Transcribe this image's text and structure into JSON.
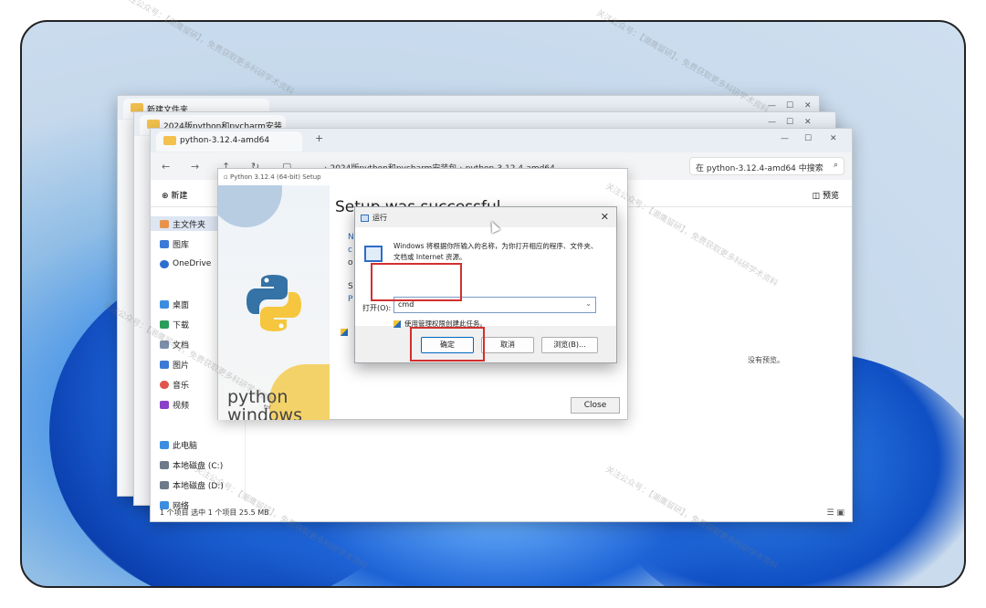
{
  "explorer_back2": {
    "tab": "新建文件夹"
  },
  "explorer_back1": {
    "tab": "2024版python和pycharm安装"
  },
  "explorer": {
    "tab": "python-3.12.4-amd64",
    "new_tab": "+",
    "win_controls": {
      "minimize": "—",
      "maximize": "☐",
      "close": "✕"
    },
    "breadcrumb": [
      "2024版python和pycharm安装包",
      "python-3.12.4-amd64"
    ],
    "breadcrumb_sep": "›",
    "search_placeholder": "在 python-3.12.4-amd64 中搜索",
    "new_button": "新建",
    "preview_button": "预览",
    "sidebar": [
      {
        "label": "主文件夹",
        "icon": "home-icon"
      },
      {
        "label": "图库",
        "icon": "gallery-icon"
      },
      {
        "label": "OneDrive",
        "icon": "cloud-icon"
      },
      {
        "label": "桌面",
        "icon": "desktop-icon"
      },
      {
        "label": "下载",
        "icon": "download-icon"
      },
      {
        "label": "文档",
        "icon": "document-icon"
      },
      {
        "label": "图片",
        "icon": "picture-icon"
      },
      {
        "label": "音乐",
        "icon": "music-icon"
      },
      {
        "label": "视频",
        "icon": "video-icon"
      },
      {
        "label": "此电脑",
        "icon": "pc-icon"
      },
      {
        "label": "本地磁盘 (C:)",
        "icon": "drive-icon"
      },
      {
        "label": "本地磁盘 (D:)",
        "icon": "drive-icon"
      },
      {
        "label": "网络",
        "icon": "network-icon"
      }
    ],
    "status": "1 个项目    选中 1 个项目  25.5 MB",
    "no_preview": "没有预览。"
  },
  "setup": {
    "title": "Python 3.12.4 (64-bit) Setup",
    "headline": "Setup was successful",
    "python_word": "python",
    "for_word": "for",
    "windows_word": "windows",
    "close_button": "Close"
  },
  "run": {
    "title": "运行",
    "description": "Windows 将根据你所输入的名称，为你打开相应的程序、文件夹、文档或 Internet 资源。",
    "open_label": "打开(O):",
    "input_value": "cmd",
    "admin_note": "使用管理权限创建此任务。",
    "ok": "确定",
    "cancel": "取消",
    "browse": "浏览(B)...",
    "close": "✕"
  },
  "watermark": "关注公众号：【潮鹰留研】，免费获取更多科研学术资料",
  "colors": {
    "highlight": "#d32f2f",
    "accent": "#0067c0"
  }
}
